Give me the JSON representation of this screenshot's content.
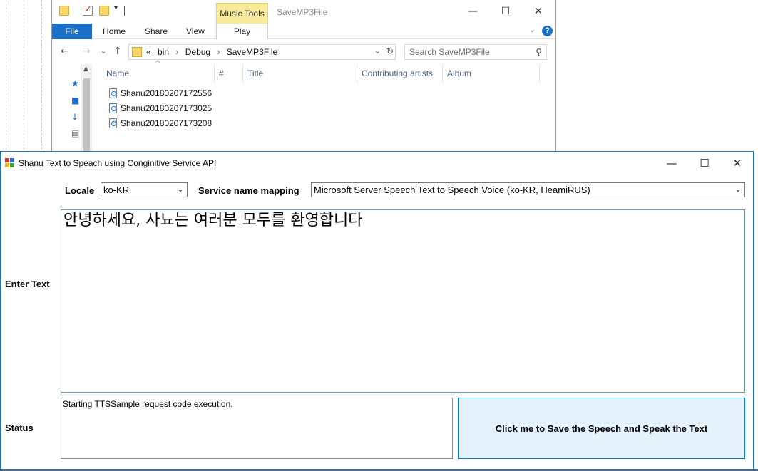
{
  "explorer": {
    "title": "SaveMP3File",
    "context_tab": "Music Tools",
    "tabs": [
      "File",
      "Home",
      "Share",
      "View",
      "Play"
    ],
    "window_controls": {
      "minimize": "—",
      "maximize": "☐",
      "close": "✕"
    },
    "breadcrumbs": [
      "«",
      "bin",
      "›",
      "Debug",
      "›",
      "SaveMP3File"
    ],
    "search_placeholder": "Search SaveMP3File",
    "columns": [
      "Name",
      "#",
      "Title",
      "Contributing artists",
      "Album"
    ],
    "files": [
      "Shanu20180207172556",
      "Shanu20180207173025",
      "Shanu20180207173208"
    ]
  },
  "app": {
    "title": "Shanu Text to Speach using Conginitive Service API",
    "window_controls": {
      "minimize": "—",
      "maximize": "☐",
      "close": "✕"
    },
    "locale_label": "Locale",
    "locale_value": "ko-KR",
    "service_label": "Service name mapping",
    "service_value": "Microsoft Server Speech Text to Speech Voice (ko-KR, HeamiRUS)",
    "enter_text_label": "Enter Text",
    "text_value": "안녕하세요, 사뇨는 여러분 모두를 환영합니다",
    "status_label": "Status",
    "status_value": "Starting TTSSample request code execution.",
    "speak_button": "Click me to Save the Speech and  Speak the Text"
  },
  "colors": {
    "accent": "#0078d7",
    "file_tab": "#1a6fc9",
    "music_tools": "#f8ec9b",
    "button_face": "#e5f1fb"
  }
}
